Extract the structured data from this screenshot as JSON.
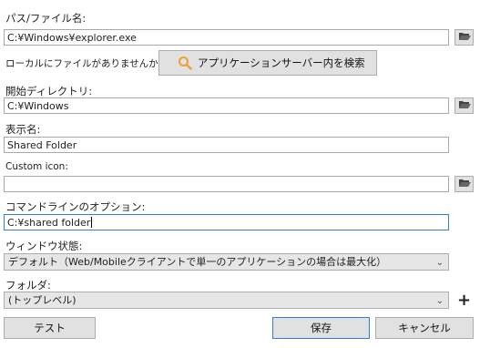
{
  "labels": {
    "path": "パス/ファイル名:",
    "local_prompt": "ローカルにファイルがありませんか？",
    "start_dir": "開始ディレクトリ:",
    "display_name": "表示名:",
    "custom_icon": "Custom icon:",
    "cmd_options": "コマンドラインのオプション:",
    "window_state": "ウィンドウ状態:",
    "folder": "フォルダ:"
  },
  "fields": {
    "path": "C:¥Windows¥explorer.exe",
    "start_dir": "C:¥Windows",
    "display_name": "Shared Folder",
    "custom_icon": "",
    "cmd_options": "C:¥shared folder"
  },
  "buttons": {
    "search_server": "アプリケーションサーバー内を検索",
    "test": "テスト",
    "save": "保存",
    "cancel": "キャンセル"
  },
  "selects": {
    "window_state": "デフォルト（Web/Mobileクライアントで単一のアプリケーションの場合は最大化）",
    "folder": "(トップレベル)"
  },
  "icons": {
    "folder_open": "folder-open-icon",
    "search": "search-icon",
    "chevron": "chevron-down-icon",
    "plus": "plus-icon"
  }
}
